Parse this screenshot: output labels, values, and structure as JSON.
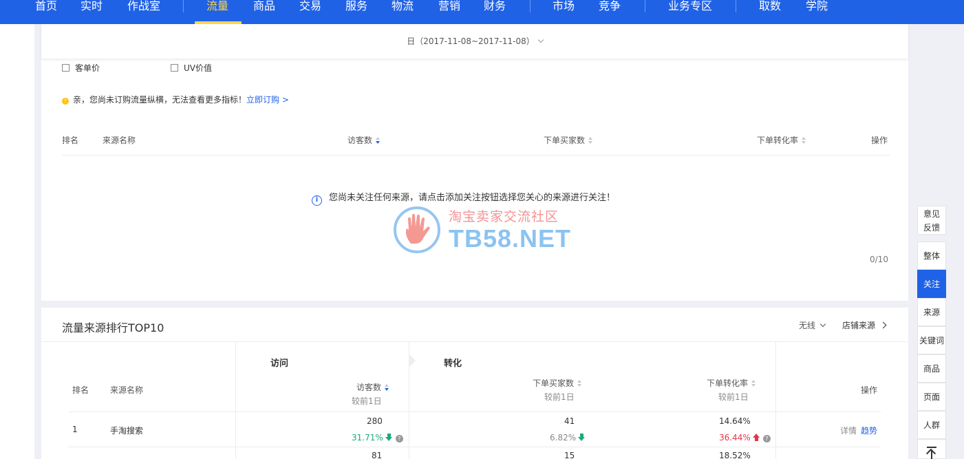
{
  "nav": {
    "items": [
      "首页",
      "实时",
      "作战室",
      "流量",
      "商品",
      "交易",
      "服务",
      "物流",
      "营销",
      "财务",
      "市场",
      "竞争",
      "业务专区",
      "取数",
      "学院"
    ],
    "active": "流量"
  },
  "date_filter": {
    "label": "日（2017-11-08~2017-11-08）"
  },
  "metric_checkboxes": [
    {
      "label": "客单价",
      "checked": false
    },
    {
      "label": "UV价值",
      "checked": false
    }
  ],
  "notice": {
    "text": "亲，您尚未订购流量纵横，无法查看更多指标！",
    "link": "立即订购 >"
  },
  "followed_table": {
    "headers": {
      "rank": "排名",
      "source": "来源名称",
      "visitors": "访客数",
      "buyers": "下单买家数",
      "conversion": "下单转化率",
      "action": "操作"
    },
    "empty_message": "您尚未关注任何来源，请点击添加关注按钮选择您关心的来源进行关注！",
    "count": "0/10"
  },
  "watermark": {
    "line1": "淘宝卖家交流社区",
    "line2": "TB58.NET"
  },
  "top10": {
    "title": "流量来源排行TOP10",
    "device_filter": "无线",
    "shop_source_link": "店铺来源",
    "groups": {
      "visit": "访问",
      "convert": "转化"
    },
    "headers": {
      "rank": "排名",
      "source": "来源名称",
      "visitors": "访客数",
      "buyers": "下单买家数",
      "conversion": "下单转化率",
      "compare": "较前1日",
      "action": "操作"
    },
    "rows": [
      {
        "rank": "1",
        "source": "手淘搜索",
        "visitors": "280",
        "visitors_change": "31.71%",
        "buyers": "41",
        "buyers_change": "6.82%",
        "conversion": "14.64%",
        "conversion_change": "36.44%",
        "action_detail": "详情",
        "action_trend": "趋势"
      },
      {
        "rank": "",
        "source": "",
        "visitors": "81",
        "buyers": "15",
        "conversion": "18.52%"
      }
    ]
  },
  "side_toolbar": {
    "feedback": "意见反馈",
    "items": [
      "整体",
      "关注",
      "来源",
      "关键词",
      "商品",
      "页面",
      "人群"
    ],
    "active": "关注"
  },
  "colors": {
    "brand_blue": "#2062e6",
    "nav_active": "#ffd54a",
    "up_red": "#e8344a",
    "down_green": "#1aad76"
  }
}
